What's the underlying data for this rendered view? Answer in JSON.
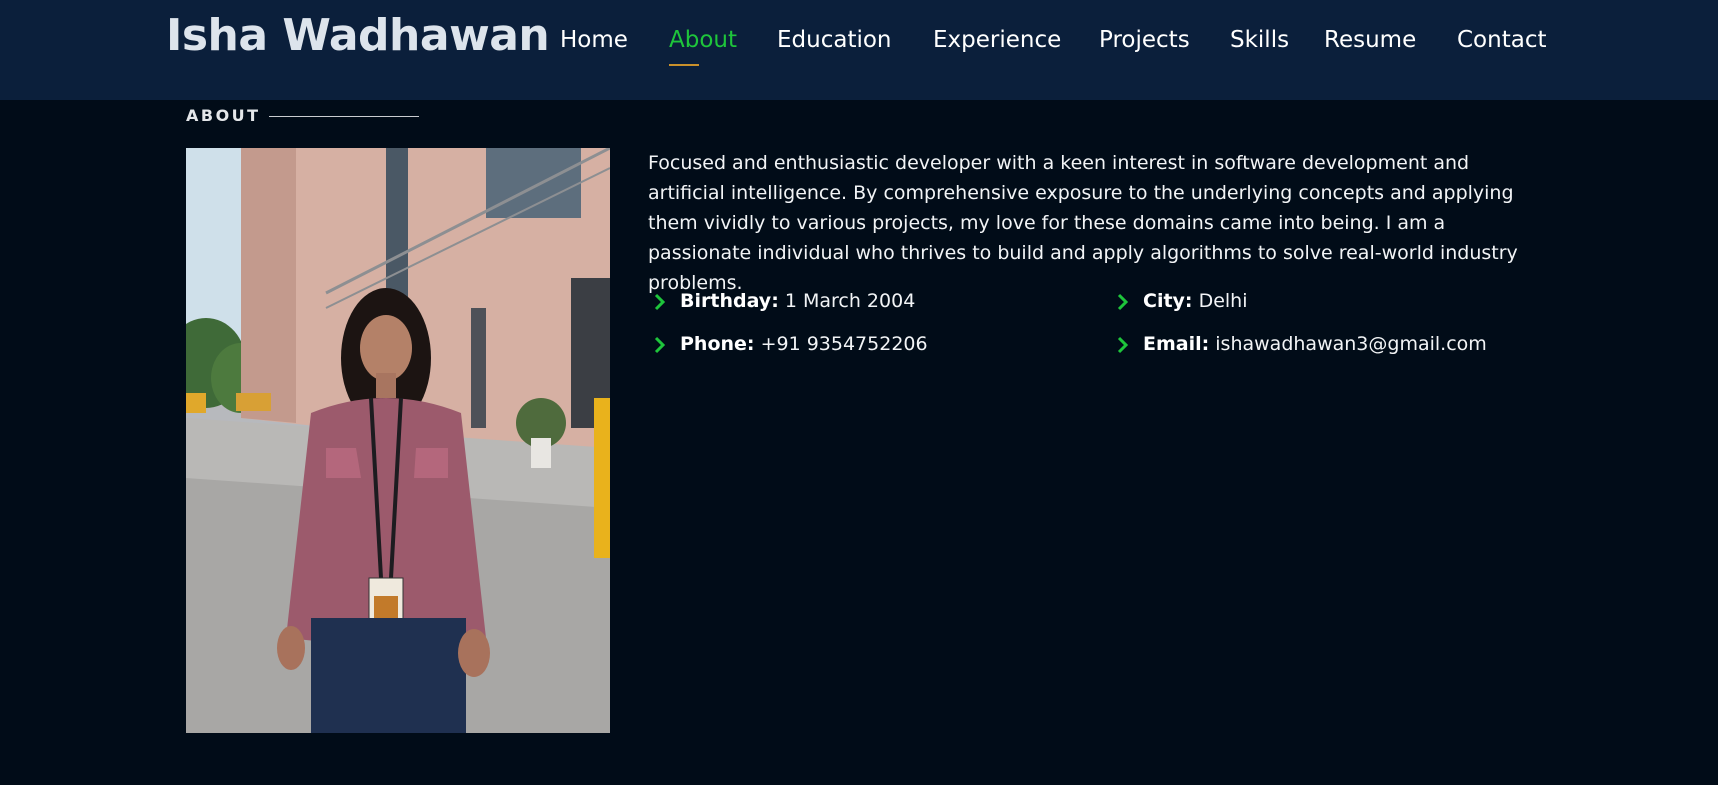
{
  "header": {
    "brand": "Isha Wadhawan",
    "nav": [
      {
        "label": "Home",
        "active": false
      },
      {
        "label": "About",
        "active": true
      },
      {
        "label": "Education",
        "active": false
      },
      {
        "label": "Experience",
        "active": false
      },
      {
        "label": "Projects",
        "active": false
      },
      {
        "label": "Skills",
        "active": false
      },
      {
        "label": "Resume",
        "active": false
      },
      {
        "label": "Contact",
        "active": false
      }
    ]
  },
  "about": {
    "section_title": "ABOUT",
    "bio": "Focused and enthusiastic developer with a keen interest in software development and artificial intelligence. By comprehensive exposure to the underlying concepts and applying them vividly to various projects, my love for these domains came into being. I am a passionate individual who thrives to build and apply algorithms to solve real-world industry problems.",
    "details": {
      "birthday": {
        "label": "Birthday:",
        "value": "1 March 2004"
      },
      "city": {
        "label": "City:",
        "value": "Delhi"
      },
      "phone": {
        "label": "Phone:",
        "value": "+91 9354752206"
      },
      "email": {
        "label": "Email:",
        "value": "ishawadhawan3@gmail.com"
      }
    },
    "bullet_icon": "chevron-right-icon"
  },
  "colors": {
    "header_bg": "#0b1f3b",
    "page_bg": "#010c18",
    "accent_green": "#1ec53b",
    "underline_gold": "#c9902b"
  }
}
